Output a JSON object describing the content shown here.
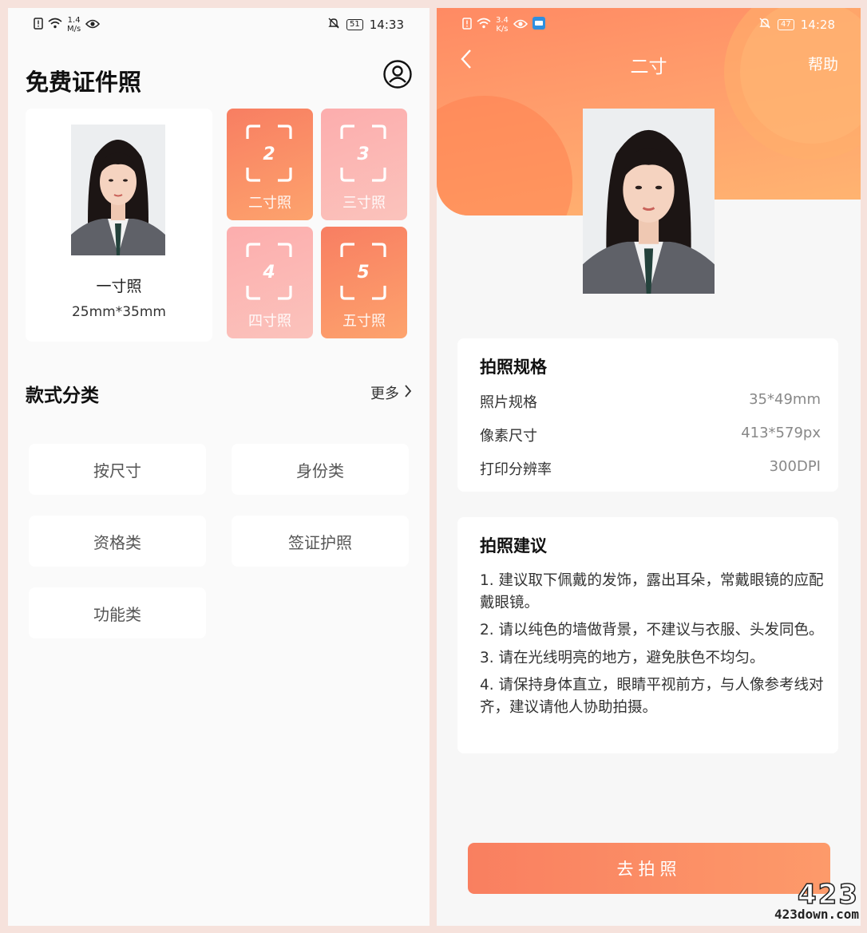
{
  "left": {
    "status": {
      "speed": "1.4\nM/s",
      "battery": "51",
      "time": "14:33"
    },
    "app_title": "免费证件照",
    "main_card": {
      "name": "一寸照",
      "size": "25mm*35mm"
    },
    "tiles": [
      {
        "num": "2",
        "label": "二寸照"
      },
      {
        "num": "3",
        "label": "三寸照"
      },
      {
        "num": "4",
        "label": "四寸照"
      },
      {
        "num": "5",
        "label": "五寸照"
      }
    ],
    "section_title": "款式分类",
    "more": "更多",
    "categories": [
      "按尺寸",
      "身份类",
      "资格类",
      "签证护照",
      "功能类"
    ]
  },
  "right": {
    "status": {
      "speed": "3.4\nK/s",
      "battery": "47",
      "time": "14:28"
    },
    "nav": {
      "title": "二寸",
      "help": "帮助"
    },
    "spec": {
      "title": "拍照规格",
      "rows": [
        {
          "k": "照片规格",
          "v": "35*49mm"
        },
        {
          "k": "像素尺寸",
          "v": "413*579px"
        },
        {
          "k": "打印分辨率",
          "v": "300DPI"
        }
      ]
    },
    "advice": {
      "title": "拍照建议",
      "items": [
        "1. 建议取下佩戴的发饰，露出耳朵，常戴眼镜的应配戴眼镜。",
        "2. 请以纯色的墙做背景，不建议与衣服、头发同色。",
        "3. 请在光线明亮的地方，避免肤色不均匀。",
        "4. 请保持身体直立，眼睛平视前方，与人像参考线对齐，建议请他人协助拍摄。"
      ]
    },
    "button": "去拍照"
  },
  "watermark": {
    "number": "423",
    "domain": "423down.com"
  },
  "colors": {
    "accent": "#f97f60",
    "accent_light": "#fcadad"
  }
}
